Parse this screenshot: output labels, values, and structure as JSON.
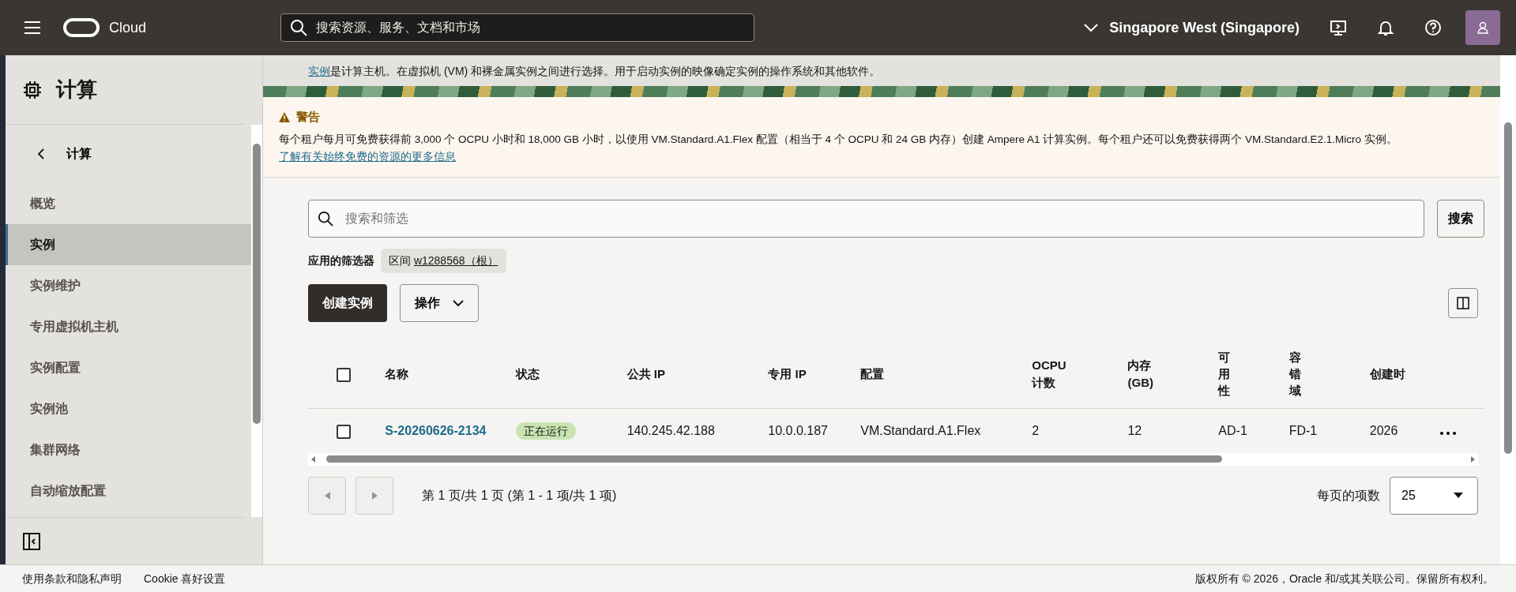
{
  "topbar": {
    "brand": "Cloud",
    "search": {
      "placeholder": "搜索资源、服务、文档和市场"
    },
    "region": "Singapore West (Singapore)"
  },
  "sidebar": {
    "title": "计算",
    "back_label": "计算",
    "items": [
      {
        "label": "概览",
        "selected": false
      },
      {
        "label": "实例",
        "selected": true
      },
      {
        "label": "实例维护",
        "selected": false
      },
      {
        "label": "专用虚拟机主机",
        "selected": false
      },
      {
        "label": "实例配置",
        "selected": false
      },
      {
        "label": "实例池",
        "selected": false
      },
      {
        "label": "集群网络",
        "selected": false
      },
      {
        "label": "自动缩放配置",
        "selected": false
      }
    ]
  },
  "footer_links": [
    "使用条款和隐私声明",
    "Cookie 喜好设置"
  ],
  "intro": {
    "link": "实例",
    "text": "是计算主机。在虚拟机 (VM) 和裸金属实例之间进行选择。用于启动实例的映像确定实例的操作系统和其他软件。"
  },
  "warning": {
    "title": "警告",
    "text": "每个租户每月可免费获得前 3,000 个 OCPU 小时和 18,000 GB 小时，以使用 VM.Standard.A1.Flex 配置（相当于 4 个 OCPU 和 24 GB 内存）创建 Ampere A1 计算实例。每个租户还可以免费获得两个 VM.Standard.E2.1.Micro 实例。",
    "link": "了解有关始终免费的资源的更多信息"
  },
  "filter": {
    "search": {
      "placeholder": "搜索和筛选"
    },
    "search_button": "搜索",
    "applied_label": "应用的筛选器",
    "chip": {
      "label": "区间",
      "value": "w1288568（根）"
    }
  },
  "actions": {
    "create": "创建实例",
    "menu": "操作"
  },
  "table": {
    "select_all": {
      "checked": false
    },
    "columns": [
      {
        "label": "名称",
        "kind": "link"
      },
      {
        "label": "状态",
        "kind": "status"
      },
      {
        "label": "公共 IP",
        "kind": "text"
      },
      {
        "label": "专用 IP",
        "kind": "text"
      },
      {
        "label": "配置",
        "kind": "text"
      },
      {
        "label": "OCPU 计数",
        "kind": "text"
      },
      {
        "label": "内存 (GB)",
        "kind": "text"
      },
      {
        "label": "可用性",
        "kind": "stacked"
      },
      {
        "label": "容错域",
        "kind": "stacked"
      },
      {
        "label": "创建时",
        "kind": "text"
      }
    ],
    "rows": [
      {
        "checked": false,
        "cells": [
          "S-20260626-2134",
          "正在运行",
          "140.245.42.188",
          "10.0.0.187",
          "VM.Standard.A1.Flex",
          "2",
          "12",
          "AD-1",
          "FD-1",
          "2026"
        ]
      }
    ]
  },
  "pagination": {
    "summary": "第 1 页/共 1 页 (第 1 - 1 项/共 1 项)",
    "per_page_label": "每页的项数",
    "per_page": "25"
  },
  "copyright": "版权所有 © 2026，Oracle 和/或其关联公司。保留所有权利。"
}
